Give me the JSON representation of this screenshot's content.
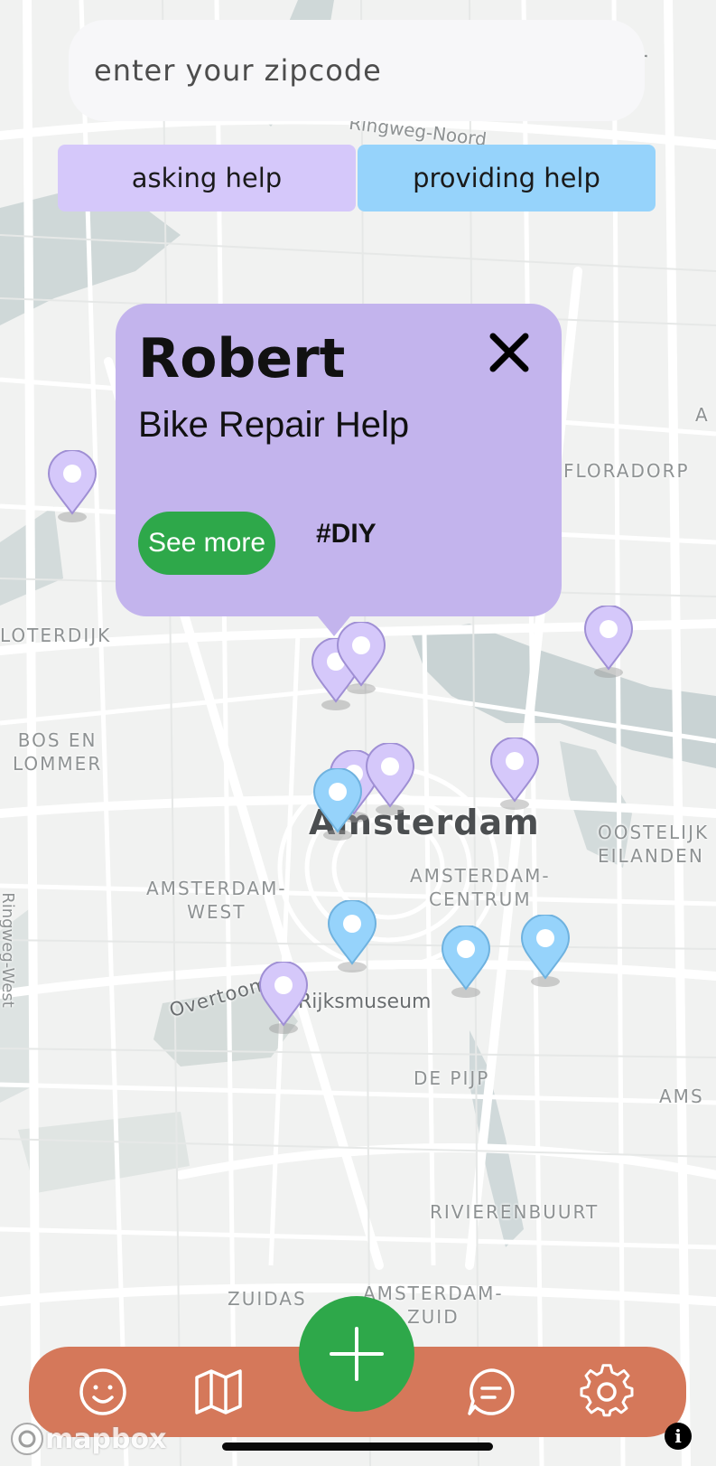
{
  "search": {
    "placeholder": "enter your zipcode",
    "value": ""
  },
  "filters": {
    "asking_label": "asking help",
    "providing_label": "providing help"
  },
  "map": {
    "labels": {
      "top_right_fragment": "er",
      "ringweg_noord": "Ringweg-Noord",
      "floradorp": "FLORADORP",
      "right_edge_a": "A",
      "sloterdijk": "LOTERDIJK",
      "bos_en_lommer": "BOS EN\nLOMMER",
      "city": "Amsterdam",
      "oostelijk": "OOSTELIJK\nEILANDEN",
      "amsterdam_west": "AMSTERDAM-\nWEST",
      "amsterdam_centrum": "AMSTERDAM-\nCENTRUM",
      "ringweg_west": "Ringweg-West",
      "overtoom": "Overtoom",
      "rijksmuseum": "Rijksmuseum",
      "de_pijp": "DE PIJP",
      "ams_fragment": "AMS",
      "rivierenbuurt": "RIVIERENBUURT",
      "zuidas": "ZUIDAS",
      "amsterdam_zuid": "AMSTERDAM-\nZUID"
    },
    "pins": [
      {
        "type": "asking",
        "color": "#d5c8fa"
      },
      {
        "type": "asking",
        "color": "#d5c8fa"
      },
      {
        "type": "asking",
        "color": "#d5c8fa"
      },
      {
        "type": "asking",
        "color": "#d5c8fa"
      },
      {
        "type": "asking",
        "color": "#d5c8fa"
      },
      {
        "type": "asking",
        "color": "#d5c8fa"
      },
      {
        "type": "asking",
        "color": "#d5c8fa"
      },
      {
        "type": "asking",
        "color": "#d5c8fa"
      },
      {
        "type": "providing",
        "color": "#96d3fb"
      },
      {
        "type": "providing",
        "color": "#96d3fb"
      },
      {
        "type": "providing",
        "color": "#96d3fb"
      },
      {
        "type": "providing",
        "color": "#96d3fb"
      }
    ]
  },
  "popup": {
    "name": "Robert",
    "title": "Bike Repair Help",
    "see_more_label": "See more",
    "tag": "#DIY",
    "color": "#c3b4ed"
  },
  "nav": {
    "items": [
      {
        "icon": "smiley-icon"
      },
      {
        "icon": "map-icon"
      },
      {
        "icon": "chat-icon"
      },
      {
        "icon": "gear-icon"
      }
    ],
    "fab_icon": "plus-icon",
    "bar_color": "#d5785a",
    "fab_color": "#2ea84a"
  },
  "attribution": {
    "logo_text": "mapbox",
    "info_label": "i"
  },
  "colors": {
    "asking": "#d5c8fa",
    "providing": "#96d3fb",
    "accent_green": "#2ea84a"
  }
}
